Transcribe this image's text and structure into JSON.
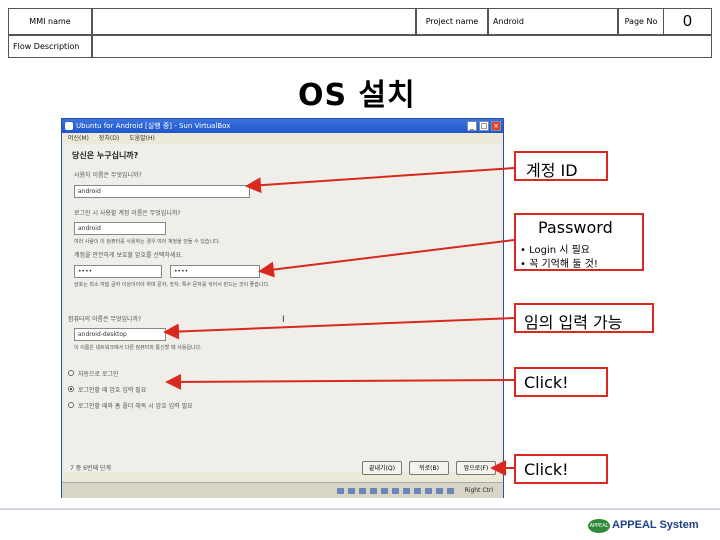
{
  "header": {
    "mmi_label": "MMI name",
    "mmi_value": "",
    "project_label": "Project name",
    "project_value": "Android",
    "page_label": "Page No",
    "page_value": "0",
    "flow_label": "Flow Description",
    "flow_value": ""
  },
  "slide": {
    "title": "OS 설치"
  },
  "window": {
    "title": "Ubuntu for Android [실행 중] - Sun VirtualBox",
    "menu": [
      "머신(M)",
      "장치(D)",
      "도움말(H)"
    ],
    "heading": "당신은 누구십니까?",
    "name_prompt": "사용자 이름은 무엇입니까?",
    "name_value": "android",
    "login_prompt": "로그인 시 사용할 계정 이름은 무엇입니까?",
    "login_value": "android",
    "login_note": "여러 사람이 이 컴퓨터를 사용하는 경우 여러 계정을 만들 수 있습니다.",
    "password_prompt": "계정을 안전하게 보호할 암호를 선택하세요.",
    "password_value": "••••",
    "password_confirm": "••••",
    "password_note": "암호는 최소 여덟 글자 이상이어야 하며 문자, 숫자, 특수 문자를 섞어서 만드는 것이 좋습니다.",
    "computer_prompt": "컴퓨터의 이름은 무엇입니까?",
    "computer_value": "android-desktop",
    "computer_note": "이 이름은 네트워크에서 다른 컴퓨터와 통신할 때 사용됩니다.",
    "radio_options": [
      "자동으로 로그인",
      "로그인할 때 암호 입력 필요",
      "로그인할 때와 홈 폴더 해독 시 암호 입력 필요"
    ],
    "step_label": "7 중 6번째 단계",
    "back_button": "뒤로(B)",
    "next_button": "앞으로(F)",
    "quit_button": "끝내기(Q)",
    "status_text": "Right Ctrl"
  },
  "annotations": {
    "account_id": "계정 ID",
    "password_title": "Password",
    "password_bullets": [
      "• Login 시 필요",
      "• 꼭 기억해 둘 것!"
    ],
    "optional_input": "임의 입력 가능",
    "click1": "Click!",
    "click2": "Click!"
  },
  "footer": {
    "logo_text": "APPEAL System",
    "logo_mark": "APPEAL"
  },
  "colors": {
    "annotation_red": "#d8281f",
    "window_titlebar": "#2156c9",
    "logo_green": "#2f8a3c"
  }
}
